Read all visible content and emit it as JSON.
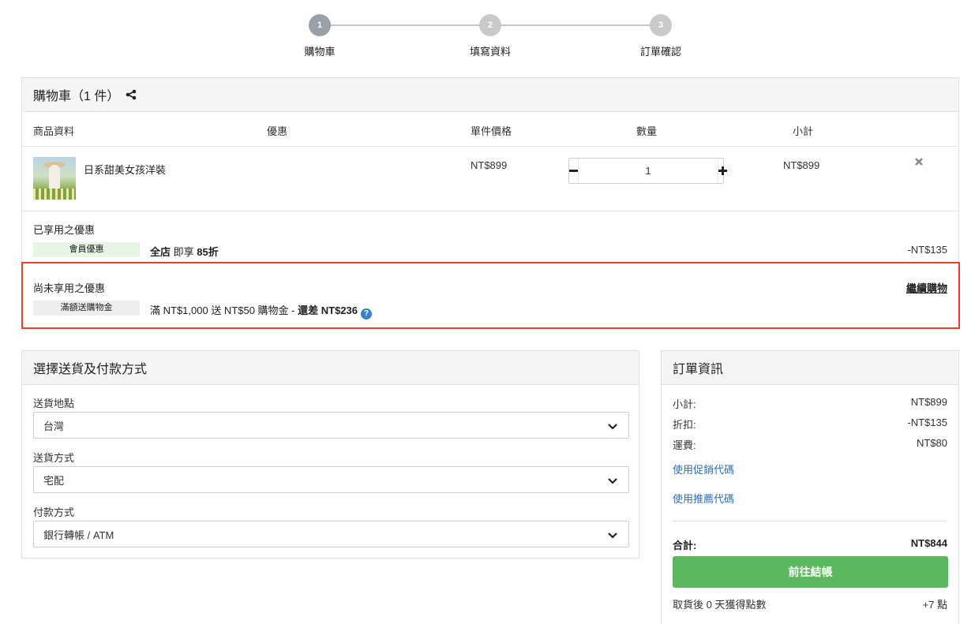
{
  "steps": [
    {
      "number": "1",
      "label": "購物車"
    },
    {
      "number": "2",
      "label": "填寫資料"
    },
    {
      "number": "3",
      "label": "訂單確認"
    }
  ],
  "cart": {
    "title": "購物車（1 件）",
    "columns": {
      "product": "商品資料",
      "promotion": "優惠",
      "unit_price": "單件價格",
      "quantity": "數量",
      "subtotal": "小計"
    },
    "items": [
      {
        "name": "日系甜美女孩洋裝",
        "unit_price": "NT$899",
        "quantity": "1",
        "subtotal": "NT$899"
      }
    ],
    "applied": {
      "title": "已享用之優惠",
      "badge": "會員優惠",
      "text_prefix": "全店",
      "text_middle": " 即享 ",
      "text_bold": "85折",
      "amount": "-NT$135"
    },
    "pending": {
      "title": "尚未享用之優惠",
      "continue_label": "繼續購物",
      "badge": "滿額送購物金",
      "text": "滿 NT$1,000 送 NT$50 購物金 - ",
      "text_bold": "還差 NT$236",
      "help_glyph": "?"
    }
  },
  "shipping": {
    "title": "選擇送貨及付款方式",
    "fields": [
      {
        "label": "送貨地點",
        "value": "台灣"
      },
      {
        "label": "送貨方式",
        "value": "宅配"
      },
      {
        "label": "付款方式",
        "value": "銀行轉帳 / ATM"
      }
    ]
  },
  "order": {
    "title": "訂單資訊",
    "subtotal_label": "小計:",
    "subtotal_value": "NT$899",
    "discount_label": "折扣:",
    "discount_value": "-NT$135",
    "shipping_label": "運費:",
    "shipping_value": "NT$80",
    "promo_code_link": "使用促銷代碼",
    "referral_code_link": "使用推薦代碼",
    "total_label": "合計:",
    "total_value": "NT$844",
    "checkout_label": "前往結帳",
    "points_label": "取貨後 0 天獲得點數",
    "points_value": "+7 點"
  },
  "colors": {
    "checkout_button": "#5cb85c",
    "highlight_border": "#e8412b",
    "link": "#2e6fb5"
  }
}
